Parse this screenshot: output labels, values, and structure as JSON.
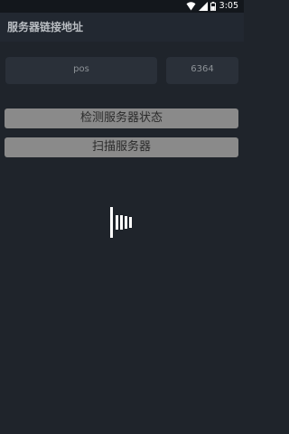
{
  "status_bar": {
    "time": "3:05",
    "icons": [
      "wifi-icon",
      "signal-icon",
      "battery-icon"
    ]
  },
  "app_bar": {
    "title": "服务器链接地址"
  },
  "form": {
    "host_value": "pos",
    "port_value": "6364"
  },
  "buttons": {
    "check_label": "检测服务器状态",
    "scan_label": "扫描服务器"
  },
  "loader": {
    "icon": "loading-bars-icon"
  },
  "colors": {
    "background": "#1f242b",
    "app_bar": "#222831",
    "field": "#2a3039",
    "button": "#8a8a8a"
  }
}
